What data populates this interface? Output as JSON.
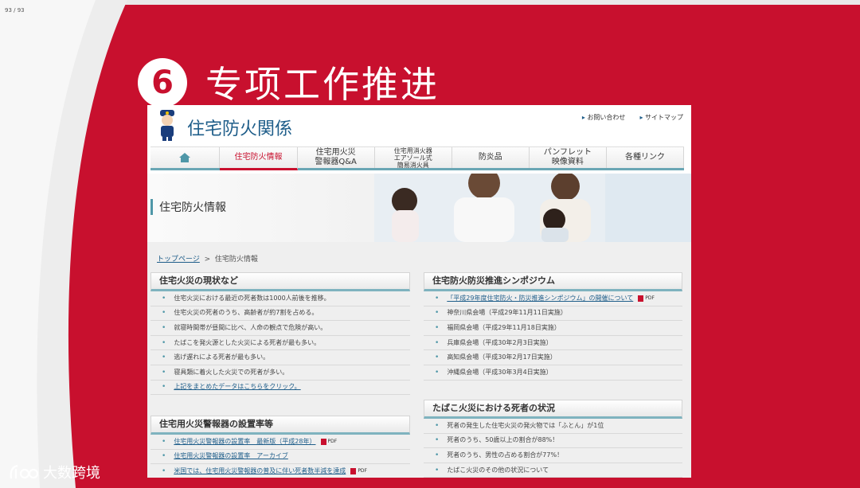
{
  "slide": {
    "page_counter": "93 / 93",
    "badge_number": "6",
    "title": "专项工作推进",
    "watermark": "大数跨境",
    "accent_color": "#c8102e"
  },
  "site": {
    "title": "住宅防火関係",
    "util_links": [
      "お問い合わせ",
      "サイトマップ"
    ],
    "nav": {
      "home_icon": "house-icon",
      "items": [
        {
          "label": "住宅防火情報",
          "active": true
        },
        {
          "label": "住宅用火災\n警報器Q&A"
        },
        {
          "label": "住宅用消火器\nエアゾール式\n簡易消火具"
        },
        {
          "label": "防炎品"
        },
        {
          "label": "パンフレット\n映像資料"
        },
        {
          "label": "各種リンク"
        }
      ]
    },
    "hero_title": "住宅防火情報",
    "breadcrumb": {
      "home": "トップページ",
      "sep": ">",
      "current": "住宅防火情報"
    },
    "panels": {
      "fire_status": {
        "title": "住宅火災の現状など",
        "items": [
          {
            "text": "住宅火災における最近の死者数は1000人前後を推移。"
          },
          {
            "text": "住宅火災の死者のうち、高齢者が約7割を占める。"
          },
          {
            "text": "就寝時間帯が昼間に比べ、人命の観点で危険が高い。"
          },
          {
            "text": "たばこを発火源とした火災による死者が最も多い。"
          },
          {
            "text": "逃げ遅れによる死者が最も多い。"
          },
          {
            "text": "寝具類に着火した火災での死者が多い。"
          },
          {
            "text": "上記をまとめたデータはこちらをクリック。",
            "link": true
          }
        ]
      },
      "alarm_rate": {
        "title": "住宅用火災警報器の設置率等",
        "items": [
          {
            "text": "住宅用火災警報器の設置率　最新版（平成28年）",
            "link": true,
            "pdf": "PDF"
          },
          {
            "text": "住宅用火災警報器の設置率　アーカイブ",
            "link": true
          },
          {
            "text": "米国では、住宅用火災警報器の普及に伴い死者数半減を達成",
            "link": true,
            "pdf": "PDF"
          }
        ]
      },
      "symposium": {
        "title": "住宅防火防災推進シンポジウム",
        "items": [
          {
            "text": "「平成29年度住宅防火・防災推進シンポジウム」の開催について",
            "link": true,
            "pdf": "PDF"
          },
          {
            "text": "神奈川県会場（平成29年11月11日実施）"
          },
          {
            "text": "福岡県会場（平成29年11月18日実施）"
          },
          {
            "text": "兵庫県会場（平成30年2月3日実施）"
          },
          {
            "text": "高知県会場（平成30年2月17日実施）"
          },
          {
            "text": "沖縄県会場（平成30年3月4日実施）"
          }
        ]
      },
      "tobacco": {
        "title": "たばこ火災における死者の状況",
        "items": [
          {
            "text": "死者の発生した住宅火災の発火物では「ふとん」が1位"
          },
          {
            "text": "死者のうち、50歳以上の割合が88%！"
          },
          {
            "text": "死者のうち、男性の占める割合が77%！"
          },
          {
            "text": "たばこ火災のその他の状況について"
          }
        ]
      }
    }
  }
}
